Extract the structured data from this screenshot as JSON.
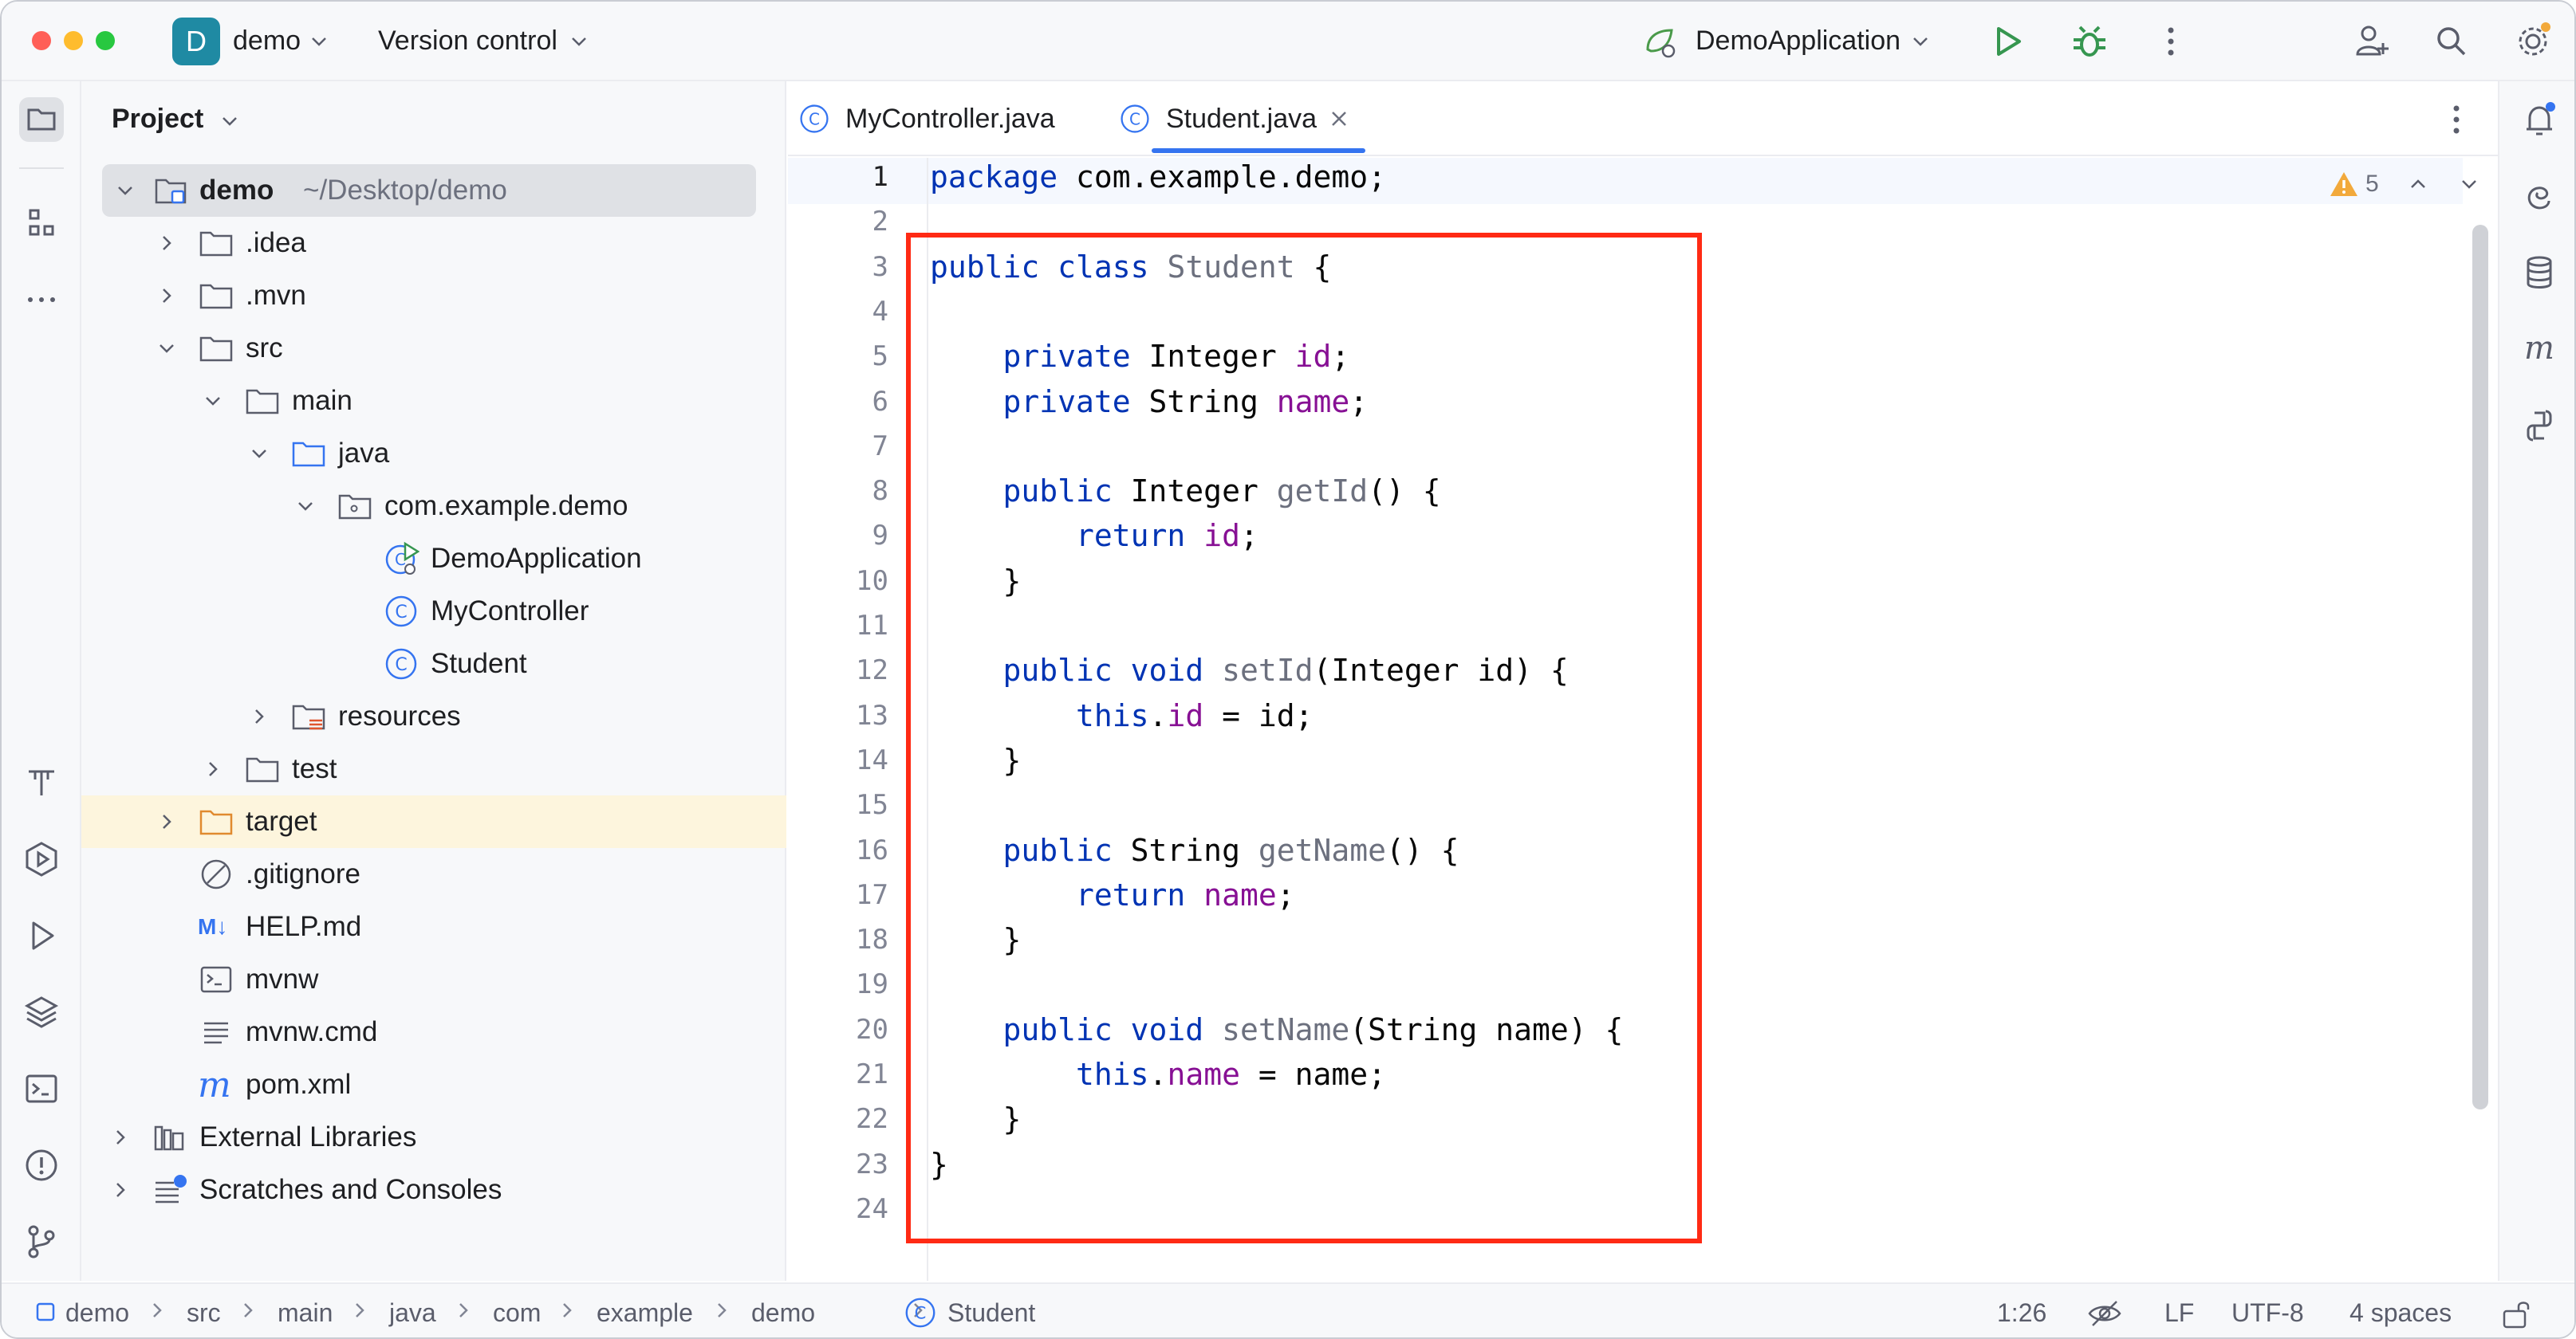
{
  "titlebar": {
    "project_badge": "D",
    "project_name": "demo",
    "vcs_label": "Version control",
    "run_config": "DemoApplication",
    "icons": [
      "run-icon",
      "debug-icon",
      "more-vertical-icon",
      "add-user-icon",
      "search-icon",
      "settings-icon"
    ]
  },
  "project_panel": {
    "title": "Project",
    "tree": [
      {
        "label": "demo",
        "suffix": "~/Desktop/demo",
        "icon": "module-folder-icon"
      },
      {
        "label": ".idea",
        "icon": "folder-icon"
      },
      {
        "label": ".mvn",
        "icon": "folder-icon"
      },
      {
        "label": "src",
        "icon": "folder-icon"
      },
      {
        "label": "main",
        "icon": "folder-icon"
      },
      {
        "label": "java",
        "icon": "source-folder-icon"
      },
      {
        "label": "com.example.demo",
        "icon": "package-icon"
      },
      {
        "label": "DemoApplication",
        "icon": "spring-class-icon"
      },
      {
        "label": "MyController",
        "icon": "class-icon"
      },
      {
        "label": "Student",
        "icon": "class-icon"
      },
      {
        "label": "resources",
        "icon": "resources-folder-icon"
      },
      {
        "label": "test",
        "icon": "folder-icon"
      },
      {
        "label": "target",
        "icon": "excluded-folder-icon"
      },
      {
        "label": ".gitignore",
        "icon": "ignored-file-icon"
      },
      {
        "label": "HELP.md",
        "icon": "markdown-icon",
        "badge": "M↓"
      },
      {
        "label": "mvnw",
        "icon": "shell-script-icon"
      },
      {
        "label": "mvnw.cmd",
        "icon": "text-file-icon"
      },
      {
        "label": "pom.xml",
        "icon": "maven-icon",
        "badge": "m"
      },
      {
        "label": "External Libraries",
        "icon": "library-icon"
      },
      {
        "label": "Scratches and Consoles",
        "icon": "scratches-icon"
      }
    ]
  },
  "editor": {
    "tabs": [
      {
        "label": "MyController.java",
        "active": false
      },
      {
        "label": "Student.java",
        "active": true
      }
    ],
    "inspection_count": "5",
    "line_numbers": [
      "1",
      "2",
      "3",
      "4",
      "5",
      "6",
      "7",
      "8",
      "9",
      "10",
      "11",
      "12",
      "13",
      "14",
      "15",
      "16",
      "17",
      "18",
      "19",
      "20",
      "21",
      "22",
      "23",
      "24"
    ],
    "code": [
      [
        [
          "kw",
          "package"
        ],
        [
          "p",
          " com.example.demo;"
        ]
      ],
      [],
      [
        [
          "kw",
          "public class"
        ],
        [
          "p",
          " "
        ],
        [
          "unused",
          "Student"
        ],
        [
          "p",
          " {"
        ]
      ],
      [],
      [
        [
          "p",
          "    "
        ],
        [
          "kw",
          "private"
        ],
        [
          "p",
          " Integer "
        ],
        [
          "fld",
          "id"
        ],
        [
          "p",
          ";"
        ]
      ],
      [
        [
          "p",
          "    "
        ],
        [
          "kw",
          "private"
        ],
        [
          "p",
          " String "
        ],
        [
          "fld",
          "name"
        ],
        [
          "p",
          ";"
        ]
      ],
      [],
      [
        [
          "p",
          "    "
        ],
        [
          "kw",
          "public"
        ],
        [
          "p",
          " Integer "
        ],
        [
          "unused",
          "getId"
        ],
        [
          "p",
          "() {"
        ]
      ],
      [
        [
          "p",
          "        "
        ],
        [
          "kw",
          "return"
        ],
        [
          "p",
          " "
        ],
        [
          "fld",
          "id"
        ],
        [
          "p",
          ";"
        ]
      ],
      [
        [
          "p",
          "    }"
        ]
      ],
      [],
      [
        [
          "p",
          "    "
        ],
        [
          "kw",
          "public void"
        ],
        [
          "p",
          " "
        ],
        [
          "unused",
          "setId"
        ],
        [
          "p",
          "(Integer id) {"
        ]
      ],
      [
        [
          "p",
          "        "
        ],
        [
          "kw",
          "this"
        ],
        [
          "p",
          "."
        ],
        [
          "fld",
          "id"
        ],
        [
          "p",
          " = id;"
        ]
      ],
      [
        [
          "p",
          "    }"
        ]
      ],
      [],
      [
        [
          "p",
          "    "
        ],
        [
          "kw",
          "public"
        ],
        [
          "p",
          " String "
        ],
        [
          "unused",
          "getName"
        ],
        [
          "p",
          "() {"
        ]
      ],
      [
        [
          "p",
          "        "
        ],
        [
          "kw",
          "return"
        ],
        [
          "p",
          " "
        ],
        [
          "fld",
          "name"
        ],
        [
          "p",
          ";"
        ]
      ],
      [
        [
          "p",
          "    }"
        ]
      ],
      [],
      [
        [
          "p",
          "    "
        ],
        [
          "kw",
          "public void"
        ],
        [
          "p",
          " "
        ],
        [
          "unused",
          "setName"
        ],
        [
          "p",
          "(String name) {"
        ]
      ],
      [
        [
          "p",
          "        "
        ],
        [
          "kw",
          "this"
        ],
        [
          "p",
          "."
        ],
        [
          "fld",
          "name"
        ],
        [
          "p",
          " = name;"
        ]
      ],
      [
        [
          "p",
          "    }"
        ]
      ],
      [
        [
          "p",
          "}"
        ]
      ],
      []
    ],
    "colors": {
      "keyword": "#0033b3",
      "field": "#871094",
      "unused": "#6c707e",
      "highlight_box": "#ff2a14"
    }
  },
  "statusbar": {
    "breadcrumbs": [
      "demo",
      "src",
      "main",
      "java",
      "com",
      "example",
      "demo",
      "Student"
    ],
    "caret": "1:26",
    "line_separator": "LF",
    "encoding": "UTF-8",
    "indent": "4 spaces"
  }
}
